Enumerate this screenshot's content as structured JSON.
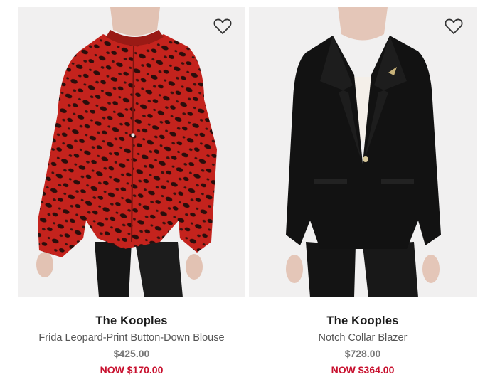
{
  "colors": {
    "sale": "#c8102e",
    "photo_bg": "#f1f0f0",
    "brand_text": "#1a1a1a",
    "name_text": "#555555",
    "original_price_text": "#777777"
  },
  "products": [
    {
      "brand": "The Kooples",
      "name": "Frida Leopard-Print Button-Down Blouse",
      "original_price": "$425.00",
      "sale_price": "NOW $170.00",
      "wishlist_icon": "heart-outline-icon"
    },
    {
      "brand": "The Kooples",
      "name": "Notch Collar Blazer",
      "original_price": "$728.00",
      "sale_price": "NOW $364.00",
      "wishlist_icon": "heart-outline-icon"
    }
  ]
}
